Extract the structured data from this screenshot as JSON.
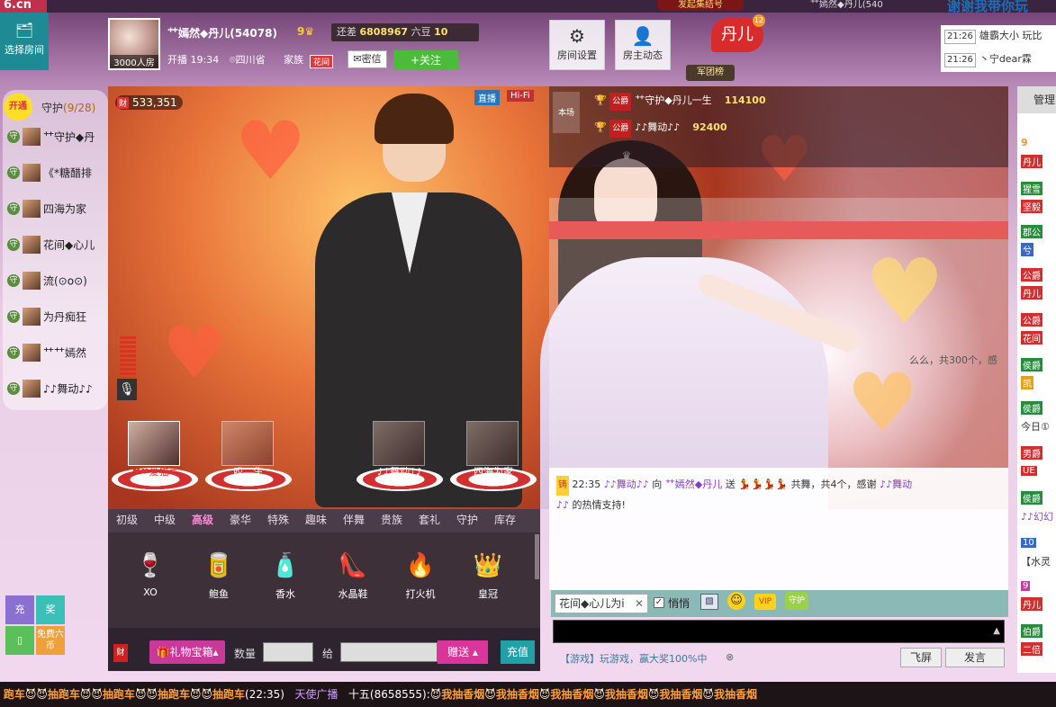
{
  "topbar": {
    "logo": "6.cn",
    "banner": "发起集结号",
    "user": "⺿嫣然◆丹儿(540",
    "title": "谢谢我带你玩"
  },
  "header": {
    "select_room": "选择房间",
    "avatar_count": "3000人房",
    "anchor_name": "⺿嫣然◆丹儿(54078)",
    "anchor_level": "9",
    "beans_prefix": "还差",
    "beans_value": "6808967",
    "beans_unit": "六豆",
    "beans_level": "10",
    "broadcast_time": "开播 19:34",
    "location": "四川省",
    "family_label": "家族",
    "family_badge": "花间",
    "private_label": "密信",
    "follow_label": "+关注",
    "room_settings": "房间设置",
    "host_feed": "房主动态",
    "host_badge": "丹儿",
    "host_badge_count": "12",
    "corps_rank": "军团榜"
  },
  "notices": [
    {
      "time": "21:26",
      "text": "雄霸大小 玩比"
    },
    {
      "time": "21:26",
      "text": "丶宁dear霖"
    }
  ],
  "guard": {
    "open": "开通",
    "title": "守护",
    "count": "(9/28)",
    "items": [
      "⺿守护◆丹",
      "《*糖醋排",
      "四海为家",
      "花间◆心儿",
      "流(⊙o⊙)",
      "为丹痴狂",
      "⺿⺿嫣然",
      "♪♪舞动♪♪"
    ]
  },
  "video": {
    "money": "533,351",
    "tag_direct": "直播",
    "tag_hifi": "Hi-Fi"
  },
  "rank": {
    "this_show": "本场",
    "rows": [
      {
        "badge": "公爵",
        "name": "⺿守护◆丹儿一生",
        "value": "114100"
      },
      {
        "badge": "公爵",
        "name": "♪♪舞动♪♪",
        "value": "92400"
      }
    ]
  },
  "seats": [
    "❤❤爱猫≡",
    "哎、生",
    "",
    "♪♪舞动♪♪",
    "四海为家"
  ],
  "gift_tabs": [
    "初级",
    "中级",
    "高级",
    "豪华",
    "特殊",
    "趣味",
    "伴舞",
    "贵族",
    "套礼",
    "守护",
    "库存"
  ],
  "gifts": [
    {
      "icon": "🍷",
      "name": "XO"
    },
    {
      "icon": "🥫",
      "name": "鲍鱼"
    },
    {
      "icon": "🧴",
      "name": "香水"
    },
    {
      "icon": "👠",
      "name": "水晶鞋"
    },
    {
      "icon": "🔥",
      "name": "打火机"
    },
    {
      "icon": "👑",
      "name": "皇冠"
    }
  ],
  "gift_bar": {
    "box": "礼物宝箱",
    "qty_label": "数量",
    "to_label": "给",
    "give": "赠送",
    "recharge": "充值",
    "wealth": "财"
  },
  "chat": {
    "faded": "么么，共300个，感",
    "time": "22:35",
    "badge": "铸",
    "sender": "♪♪舞动♪♪",
    "verb": "向",
    "receiver": "⺿嫣然◆丹儿",
    "action": "送",
    "gift_desc": "共舞，共4个，感谢",
    "thanks_user": "♪♪舞动",
    "thanks_user2": "♪♪",
    "tail": "的热情支持!"
  },
  "chat_input": {
    "target": "花间◆心儿为i",
    "whisper": "悄悄",
    "vip": "VIP",
    "guard_icon": "守护",
    "game_ad": "【游戏】玩游戏，赢大奖100%中",
    "fly": "飞屏",
    "send": "发言"
  },
  "side": {
    "charge": "充",
    "prize": "奖",
    "free": "免费六币"
  },
  "manage": {
    "title": "管理",
    "items": [
      "9",
      "丹儿",
      "猩雪",
      "坚毅",
      "郡公",
      "兮",
      "公爵",
      "丹儿",
      "公爵",
      "花间",
      "侯爵",
      "凯",
      "侯爵",
      "今日①",
      "男爵",
      "UE",
      "侯爵",
      "♪♪幻幻",
      "10",
      "【水灵",
      "9",
      "丹儿",
      "伯爵",
      "二倍"
    ]
  },
  "ticker": {
    "segments": [
      "跑车",
      "抽跑车",
      "抽跑车",
      "抽跑车",
      "抽跑车",
      "(22:35)",
      "天使广播",
      "十五(8658555):",
      "我抽香烟",
      "我抽香烟",
      "我抽香烟",
      "我抽香烟",
      "我抽香烟",
      "我抽香烟"
    ]
  }
}
